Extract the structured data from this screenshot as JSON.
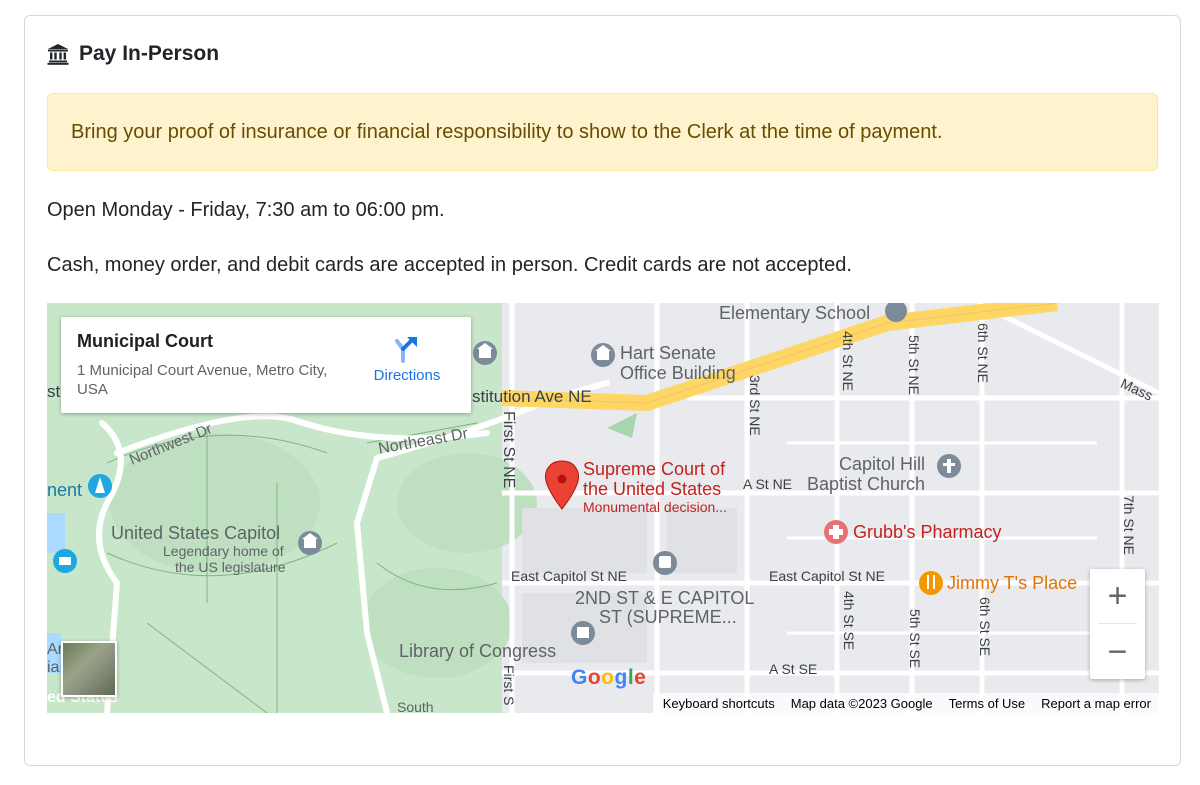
{
  "card": {
    "title": "Pay In-Person",
    "title_icon": "bank-icon"
  },
  "alert": {
    "text": "Bring your proof of insurance or financial responsibility to show to the Clerk at the time of payment."
  },
  "hours_text": "Open Monday - Friday, 7:30 am to 06:00 pm.",
  "payment_text": "Cash, money order, and debit cards are accepted in person. Credit cards are not accepted.",
  "map": {
    "info": {
      "name": "Municipal Court",
      "address": "1 Municipal Court Avenue, Metro City, USA",
      "directions_label": "Directions"
    },
    "labels": {
      "elementary_school": "Elementary School",
      "hart_senate_1": "Hart Senate",
      "hart_senate_2": "Office Building",
      "constitution_ave": "stitution Ave NE",
      "northwest_dr": "Northwest Dr",
      "northeast_dr": "Northeast Dr",
      "first_st_ne": "First St NE",
      "third_st_ne": "3rd St NE",
      "fourth_st_ne": "4th St NE",
      "fifth_st_ne": "5th St NE",
      "sixth_st_ne": "6th St NE",
      "seventh_st_ne": "7th St NE",
      "mass": "Mass",
      "supreme_court_1": "Supreme Court of",
      "supreme_court_2": "the United States",
      "supreme_court_3": "Monumental decision...",
      "a_st_ne": "A St NE",
      "capitol_hill_1": "Capitol Hill",
      "capitol_hill_2": "Baptist Church",
      "grubbs": "Grubb's Pharmacy",
      "jimmy": "Jimmy T's Place",
      "us_capitol": "United States Capitol",
      "legendary_1": "Legendary home of",
      "legendary_2": "the US legislature",
      "nent": "nent",
      "east_capitol_1": "East Capitol St NE",
      "east_capitol_2": "East Capitol St NE",
      "station_1": "2ND ST & E CAPITOL",
      "station_2": "ST (SUPREME...",
      "library": "Library of Congress",
      "fourth_st_se": "4th St SE",
      "fifth_st_se": "5th St SE",
      "sixth_st_se": "6th St SE",
      "a_st_se": "A St SE",
      "first_st_se": "First S",
      "south": "South",
      "st_left": "st",
      "am_left": "Ar",
      "ia_left": "ia",
      "ed_states": "ed States"
    },
    "google_logo": "Google",
    "attribution": {
      "keyboard": "Keyboard shortcuts",
      "data": "Map data ©2023 Google",
      "terms": "Terms of Use",
      "report": "Report a map error"
    },
    "zoom_in": "+",
    "zoom_out": "−",
    "colors": {
      "park": "#c8e6c9",
      "road_major": "#fdd663",
      "road": "#ffffff",
      "land": "#e8eaed",
      "pin": "#ea4335"
    }
  }
}
